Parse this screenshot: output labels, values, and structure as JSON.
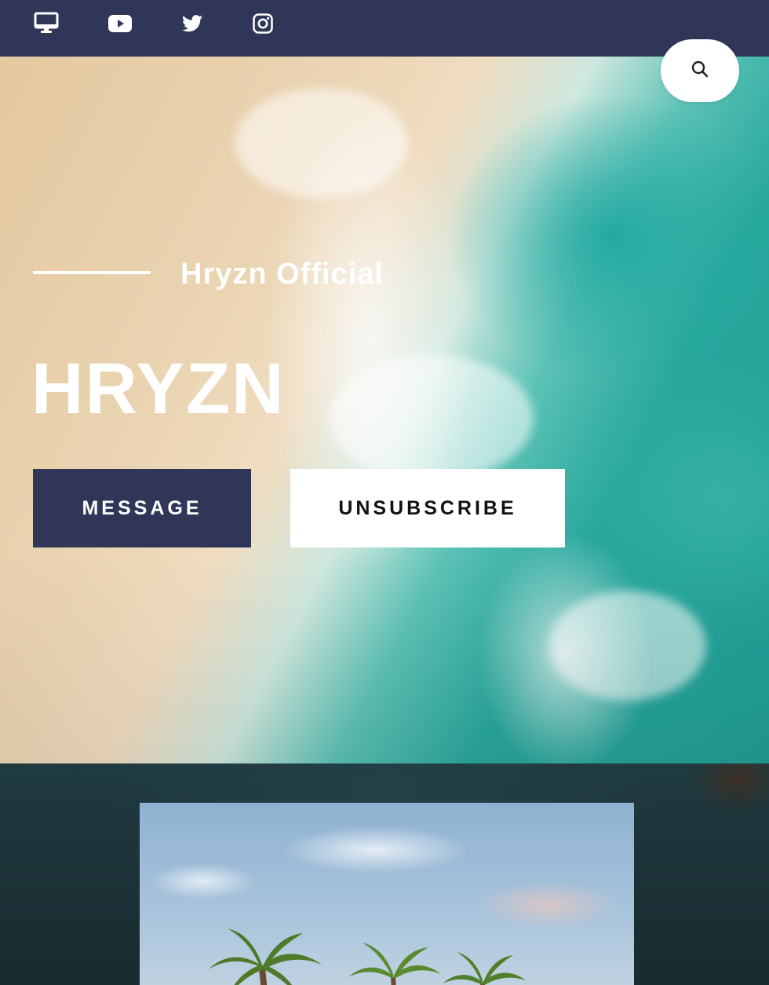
{
  "topbar": {
    "icons": [
      "desktop-icon",
      "youtube-icon",
      "twitter-icon",
      "instagram-icon"
    ],
    "background": "#2f3657"
  },
  "search": {
    "icon": "search-icon"
  },
  "hero": {
    "channel_name": "Hryzn Official",
    "channel_handle": "HRYZN",
    "message_label": "MESSAGE",
    "unsubscribe_label": "UNSUBSCRIBE",
    "accent": "#2f3657"
  }
}
